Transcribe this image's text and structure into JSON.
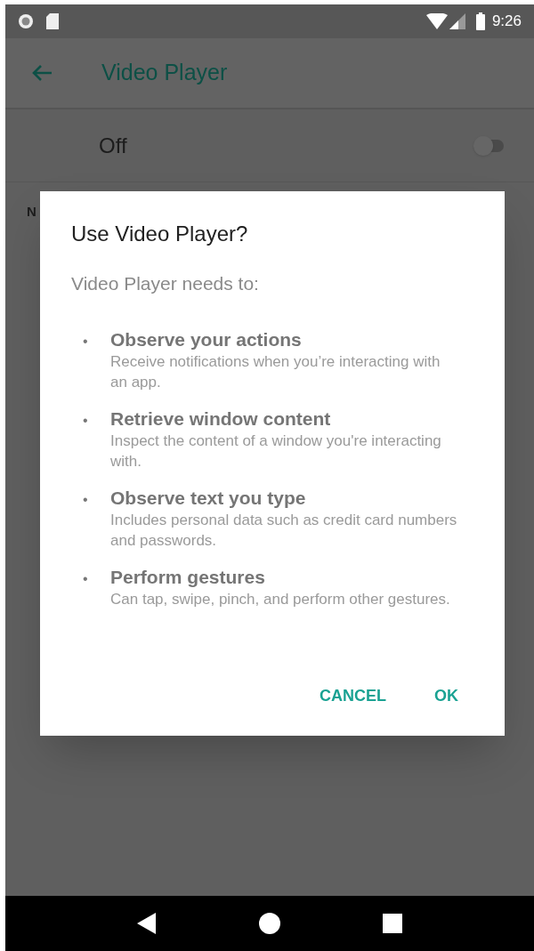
{
  "status_bar": {
    "time": "9:26"
  },
  "app_bar": {
    "title": "Video Player"
  },
  "master_switch": {
    "label": "Off",
    "on": false
  },
  "background_text": "N",
  "dialog": {
    "title": "Use Video Player?",
    "subtitle": "Video Player needs to:",
    "permissions": [
      {
        "bullet": "•",
        "title": "Observe your actions",
        "description": "Receive notifications when you’re interacting with an app."
      },
      {
        "bullet": "•",
        "title": "Retrieve window content",
        "description": "Inspect the content of a window you're interacting with."
      },
      {
        "bullet": "•",
        "title": "Observe text you type",
        "description": "Includes personal data such as credit card numbers and passwords."
      },
      {
        "bullet": "•",
        "title": "Perform gestures",
        "description": "Can tap, swipe, pinch, and perform other gestures."
      }
    ],
    "buttons": [
      "CANCEL",
      "OK"
    ]
  }
}
